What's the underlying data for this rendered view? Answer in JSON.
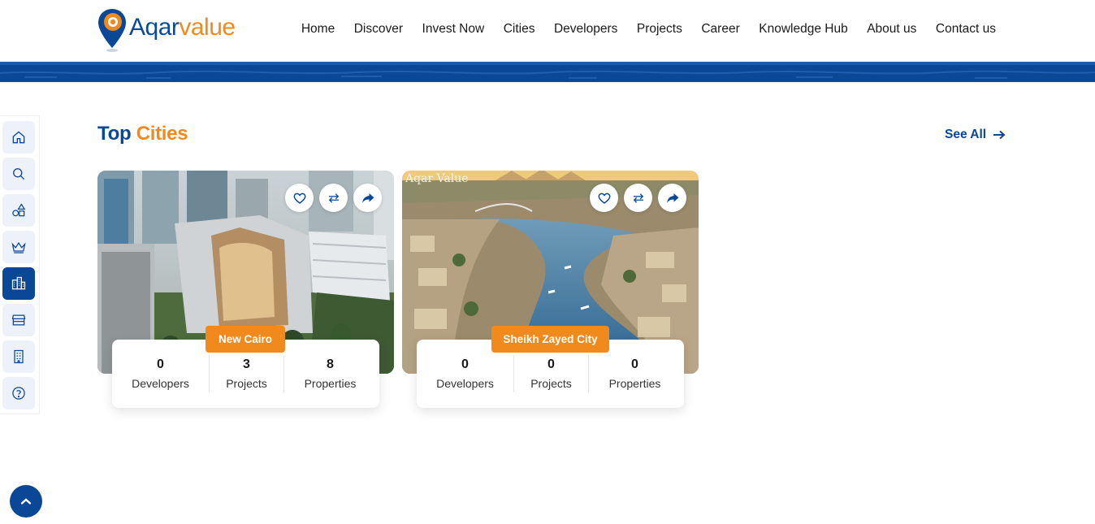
{
  "brand": {
    "name_part1": "Aqar",
    "name_part2": "value",
    "primary": "#0a4797",
    "accent": "#f08a1c"
  },
  "nav": {
    "items": [
      "Home",
      "Discover",
      "Invest Now",
      "Cities",
      "Developers",
      "Projects",
      "Career",
      "Knowledge Hub",
      "About us",
      "Contact us"
    ]
  },
  "sidebar": {
    "items": [
      {
        "icon": "home-icon",
        "active": false
      },
      {
        "icon": "search-icon",
        "active": false
      },
      {
        "icon": "shapes-icon",
        "active": false
      },
      {
        "icon": "crown-icon",
        "active": false
      },
      {
        "icon": "city-icon",
        "active": true
      },
      {
        "icon": "store-icon",
        "active": false
      },
      {
        "icon": "building-icon",
        "active": false
      },
      {
        "icon": "help-icon",
        "active": false
      }
    ]
  },
  "section": {
    "title_part1": "Top",
    "title_part2": "Cities",
    "see_all": "See All"
  },
  "cities": [
    {
      "name": "New Cairo",
      "developers": "0",
      "projects": "3",
      "properties": "8",
      "watermark": ""
    },
    {
      "name": "Sheikh Zayed City",
      "developers": "0",
      "projects": "0",
      "properties": "0",
      "watermark": "Aqar Value"
    }
  ],
  "stat_labels": {
    "developers": "Developers",
    "projects": "Projects",
    "properties": "Properties"
  }
}
